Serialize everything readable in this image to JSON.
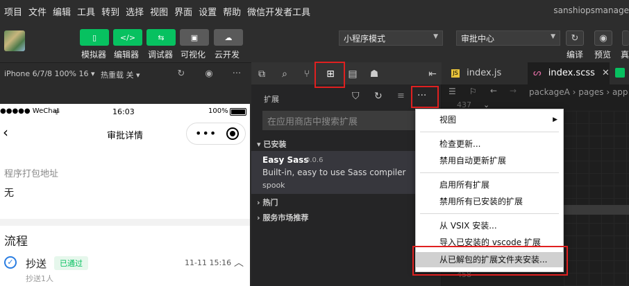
{
  "menubar": {
    "items": [
      "项目",
      "文件",
      "编辑",
      "工具",
      "转到",
      "选择",
      "视图",
      "界面",
      "设置",
      "帮助",
      "微信开发者工具"
    ],
    "project_name": "sanshiopsmanage"
  },
  "toolbar": {
    "buttons": [
      "模拟器",
      "编辑器",
      "调试器",
      "可视化",
      "云开发"
    ],
    "mode_select": "小程序模式",
    "page_select": "审批中心",
    "right_buttons": [
      "编译",
      "预览",
      "真"
    ]
  },
  "simulator": {
    "device": "iPhone 6/7/8 100% 16",
    "hotreload": "热重载 关",
    "status_left": "●●●●● WeChat",
    "status_time": "16:03",
    "status_battery": "100%",
    "nav_title": "审批详情",
    "field_label": "程序打包地址",
    "field_value": "无",
    "section_title": "流程",
    "step_title": "抄送",
    "step_badge": "已通过",
    "step_time": "11-11 15:16",
    "step_sub": "抄送1人"
  },
  "extensions": {
    "panel_title": "扩展",
    "search_placeholder": "在应用商店中搜索扩展",
    "installed_label": "已安装",
    "ext_name": "Easy Sass",
    "ext_version": "0.0.6",
    "ext_desc": "Built-in, easy to use Sass compiler",
    "ext_author": "spook",
    "hot_label": "热门",
    "market_label": "服务市场推荐"
  },
  "editor": {
    "tabs": [
      "index.js",
      "index.scss"
    ],
    "breadcrumb": "packageA › pages › app",
    "line_top": "437",
    "line_bottom": "458"
  },
  "context_menu": {
    "items": [
      "视图",
      "检查更新...",
      "禁用自动更新扩展",
      "启用所有扩展",
      "禁用所有已安装的扩展",
      "从 VSIX 安装...",
      "导入已安装的 vscode 扩展",
      "从已解包的扩展文件夹安装..."
    ]
  },
  "colors": {
    "accent_green": "#07c160",
    "highlight_red": "#e02020",
    "menu_bg": "#ffffff"
  }
}
